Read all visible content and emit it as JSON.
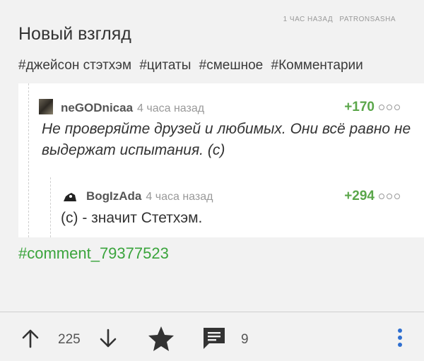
{
  "post": {
    "time_ago": "1 час назад",
    "author": "PATRONSASHA",
    "title": "Новый взгляд",
    "tags": [
      "#джейсон стэтхэм",
      "#цитаты",
      "#смешное",
      "#Комментарии"
    ]
  },
  "comments": [
    {
      "nick": "neGODnicaa",
      "time": "4 часа назад",
      "rating": "+170",
      "text": "Не проверяйте друзей и любимых. Они всё равно не выдержат испытания. (с)"
    },
    {
      "nick": "BogIzAda",
      "time": "4 часа назад",
      "rating": "+294",
      "text": "(с) - значит Стетхэм."
    }
  ],
  "permalink": "#comment_79377523",
  "toolbar": {
    "vote_count": "225",
    "comment_count": "9"
  },
  "colors": {
    "accent_green": "#3aa43c",
    "rating_green": "#5aa64a",
    "background": "#f2f2f2"
  },
  "icons": {
    "upvote": "arrow-up-icon",
    "downvote": "arrow-down-icon",
    "favorite": "star-icon",
    "comments": "comment-icon",
    "more": "kebab-menu-icon"
  }
}
